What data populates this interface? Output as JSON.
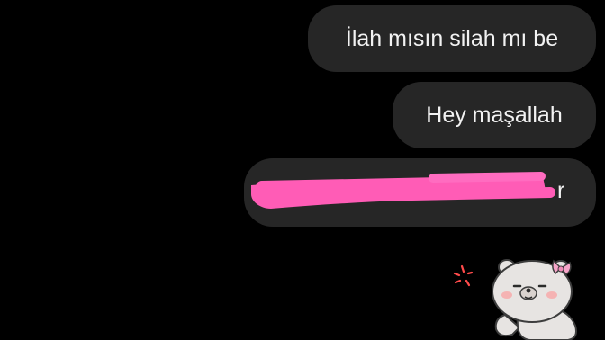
{
  "messages": [
    {
      "text": "İlah mısın silah mı be"
    },
    {
      "text": "Hey maşallah"
    },
    {
      "text": "",
      "redacted": true,
      "visible_fragment": "r"
    }
  ],
  "colors": {
    "background": "#000000",
    "bubble": "#262626",
    "text": "#f2f2f2",
    "redaction": "#ff5cb6"
  },
  "sticker": {
    "icon": "bear-sticker-icon"
  }
}
